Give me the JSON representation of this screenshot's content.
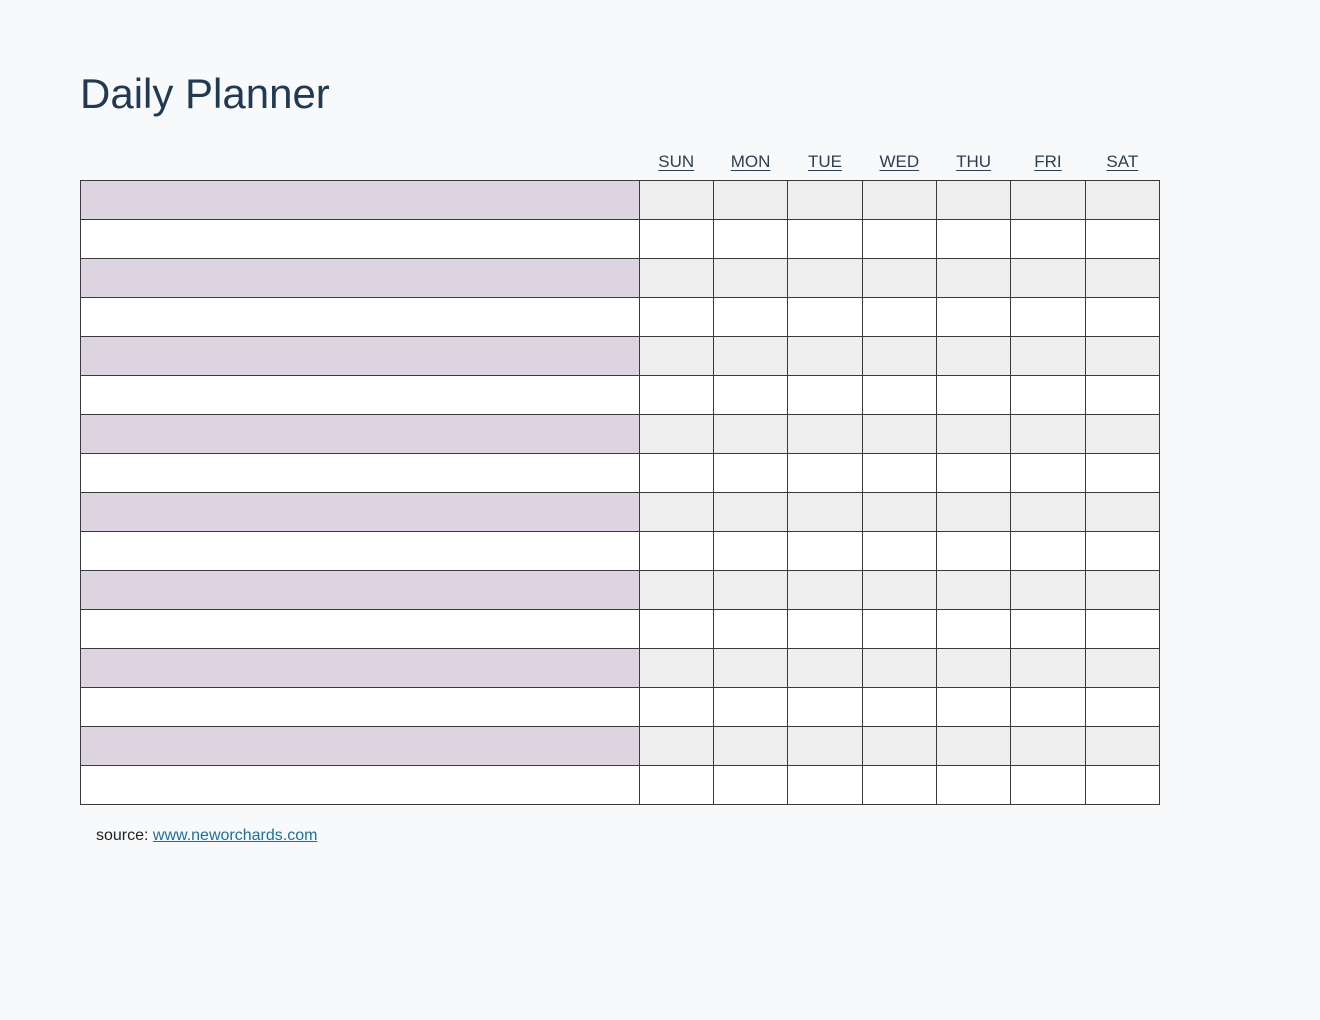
{
  "title": "Daily Planner",
  "days": [
    "SUN",
    "MON",
    "TUE",
    "WED",
    "THU",
    "FRI",
    "SAT"
  ],
  "rows": 16,
  "source": {
    "label": "source: ",
    "link_text": "www.neworchards.com"
  }
}
